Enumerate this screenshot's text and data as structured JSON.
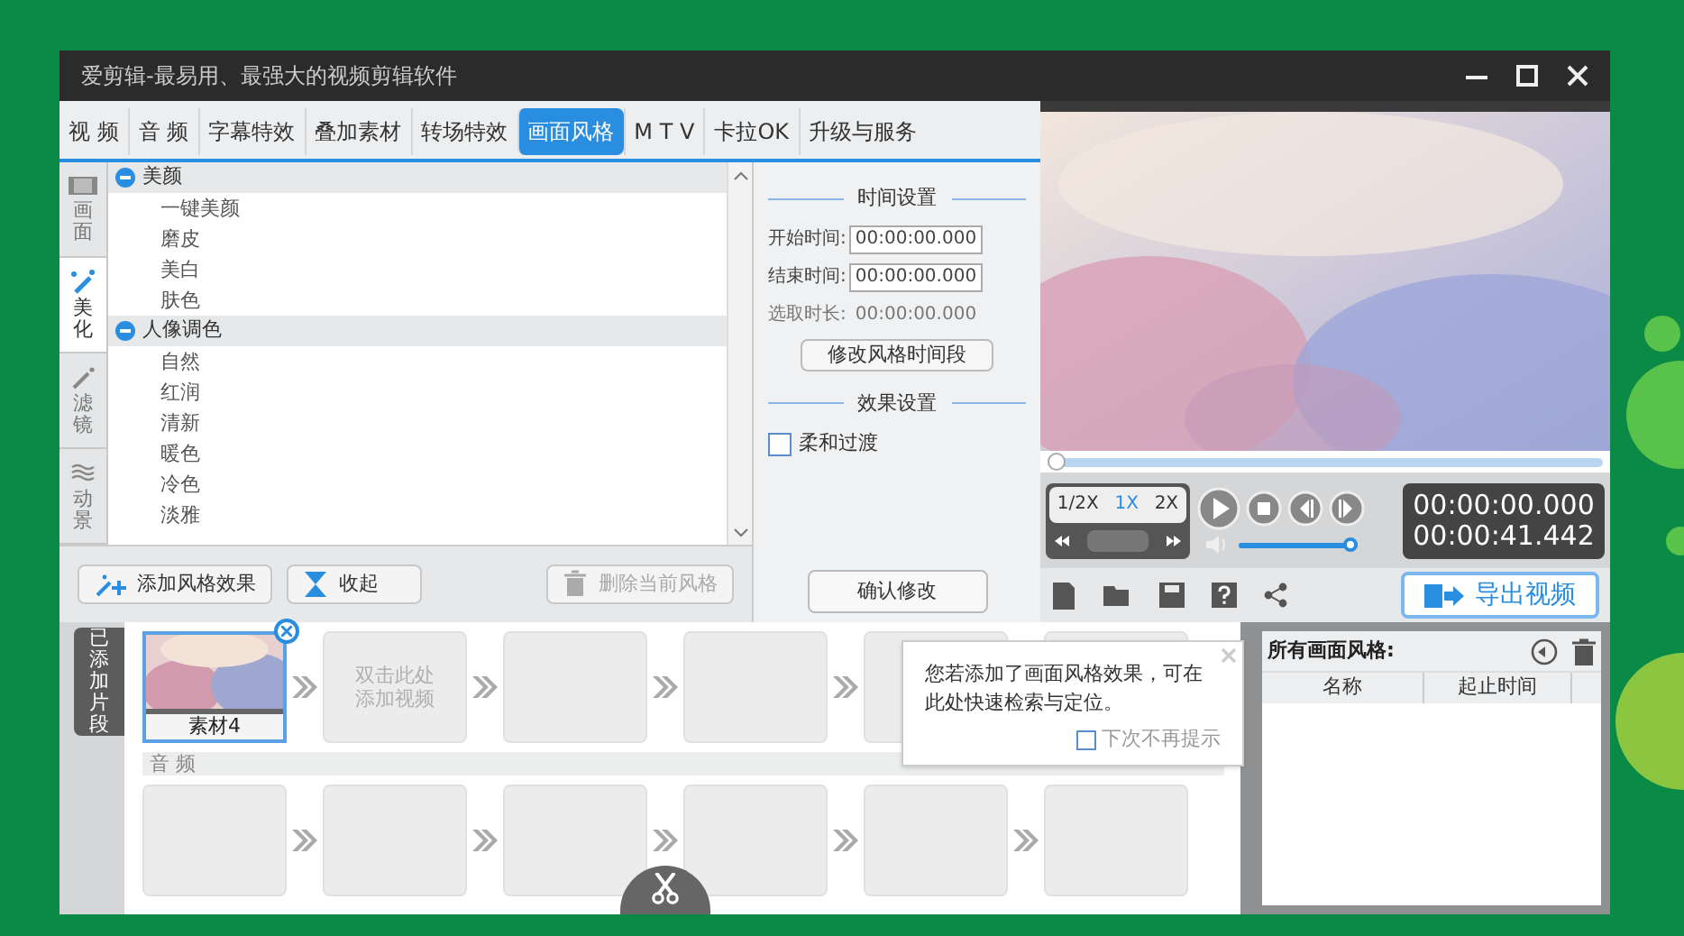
{
  "window": {
    "title": "爱剪辑-最易用、最强大的视频剪辑软件"
  },
  "tabs": [
    {
      "label": "视 频",
      "selected": false
    },
    {
      "label": "音 频",
      "selected": false
    },
    {
      "label": "字幕特效",
      "selected": false
    },
    {
      "label": "叠加素材",
      "selected": false
    },
    {
      "label": "转场特效",
      "selected": false
    },
    {
      "label": "画面风格",
      "selected": true
    },
    {
      "label": "M T V",
      "selected": false
    },
    {
      "label": "卡拉OK",
      "selected": false
    },
    {
      "label": "升级与服务",
      "selected": false
    }
  ],
  "side_tabs": [
    {
      "label": "画面",
      "kind": "film",
      "selected": false
    },
    {
      "label": "美化",
      "kind": "wand",
      "selected": true
    },
    {
      "label": "滤镜",
      "kind": "magic",
      "selected": false
    },
    {
      "label": "动景",
      "kind": "wave",
      "selected": false
    }
  ],
  "style_tree": [
    {
      "label": "美颜",
      "expanded": true,
      "children": [
        {
          "label": "一键美颜"
        },
        {
          "label": "磨皮"
        },
        {
          "label": "美白"
        },
        {
          "label": "肤色"
        }
      ]
    },
    {
      "label": "人像调色",
      "expanded": true,
      "children": [
        {
          "label": "自然"
        },
        {
          "label": "红润"
        },
        {
          "label": "清新"
        },
        {
          "label": "暖色"
        },
        {
          "label": "冷色"
        },
        {
          "label": "淡雅"
        }
      ]
    }
  ],
  "time_settings": {
    "title": "时间设置",
    "start_label": "开始时间:",
    "start_value": "00:00:00.000",
    "end_label": "结束时间:",
    "end_value": "00:00:00.000",
    "duration_label": "选取时长:",
    "duration_value": "00:00:00.000",
    "modify_button": "修改风格时间段"
  },
  "effect_settings": {
    "title": "效果设置",
    "checkbox": {
      "label": "柔和过渡",
      "checked": false
    }
  },
  "confirm_button": "确认修改",
  "style_buttons": [
    {
      "label": "添加风格效果",
      "kind": "add",
      "disabled": false
    },
    {
      "label": "收起",
      "kind": "collapse",
      "disabled": false
    },
    {
      "label": "删除当前风格",
      "kind": "delete",
      "disabled": true
    }
  ],
  "player": {
    "progress": {
      "level": 0
    },
    "speeds": [
      {
        "label": "1/2X",
        "selected": false
      },
      {
        "label": "1X",
        "selected": true
      },
      {
        "label": "2X",
        "selected": false
      }
    ],
    "volume": {
      "level": 1
    },
    "current_time": "00:00:00.000",
    "total_time": "00:00:41.442"
  },
  "export_button": "导出视频",
  "timeline": {
    "side_label": "已添加片段",
    "video_clips": [
      {
        "kind": "clip",
        "label": "素材4"
      },
      {
        "kind": "placeholder",
        "label": "双击此处添加视频"
      },
      {
        "kind": "empty"
      },
      {
        "kind": "empty"
      },
      {
        "kind": "empty"
      },
      {
        "kind": "empty"
      }
    ],
    "audio_label": "音 频",
    "audio_clips": [
      {
        "kind": "empty"
      },
      {
        "kind": "empty"
      },
      {
        "kind": "empty"
      },
      {
        "kind": "empty"
      },
      {
        "kind": "empty"
      },
      {
        "kind": "empty"
      }
    ]
  },
  "tooltip": {
    "text": "您若添加了画面风格效果，可在此处快速检索与定位。",
    "checkbox": {
      "label": "下次不再提示",
      "checked": false
    }
  },
  "style_list": {
    "title": "所有画面风格:",
    "columns": [
      "名称",
      "起止时间"
    ]
  }
}
